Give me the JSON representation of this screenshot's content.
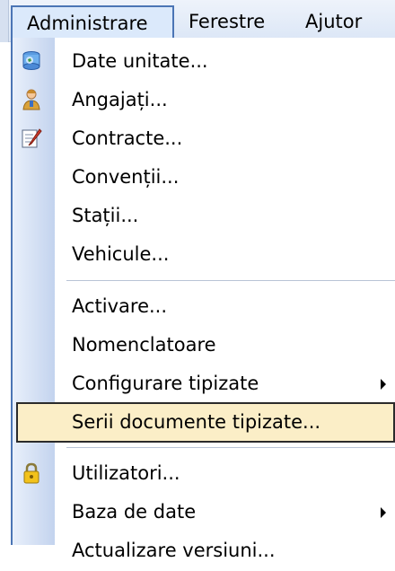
{
  "menubar": {
    "items": [
      "Administrare",
      "Ferestre",
      "Ajutor"
    ]
  },
  "menu": {
    "items": [
      {
        "label": "Date unitate...",
        "icon": "globe-database-icon"
      },
      {
        "label": "Angajați...",
        "icon": "person-icon"
      },
      {
        "label": "Contracte...",
        "icon": "document-edit-icon"
      },
      {
        "label": "Convenții..."
      },
      {
        "label": "Stații..."
      },
      {
        "label": "Vehicule..."
      },
      {
        "label": "Activare..."
      },
      {
        "label": "Nomenclatoare"
      },
      {
        "label": "Configurare tipizate",
        "submenu": true
      },
      {
        "label": "Serii documente tipizate...",
        "highlighted": true
      },
      {
        "label": "Utilizatori...",
        "icon": "lock-icon"
      },
      {
        "label": "Baza de date",
        "submenu": true
      },
      {
        "label": "Actualizare versiuni..."
      }
    ]
  },
  "colors": {
    "highlight": "#fbeec7",
    "menubar_active_border": "#4b75b5",
    "gutter": "#c3d3ee"
  }
}
